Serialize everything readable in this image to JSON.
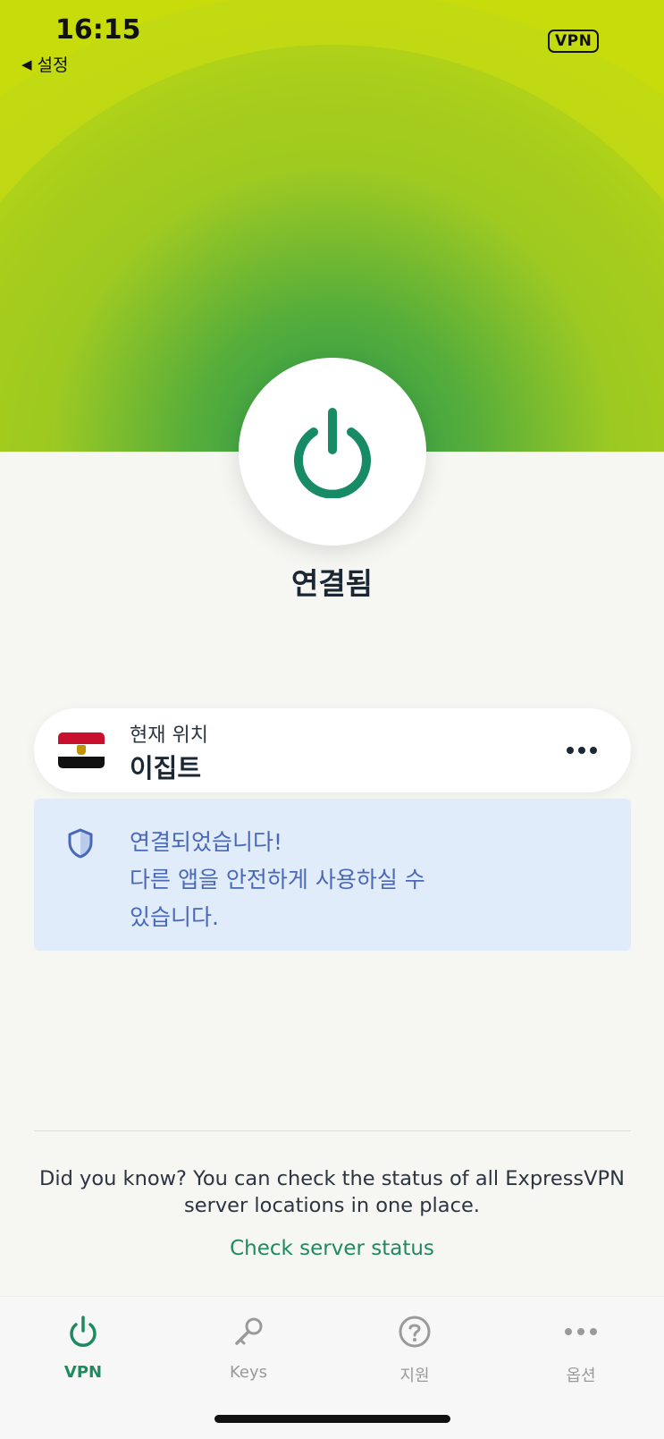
{
  "status_bar": {
    "time": "16:15",
    "back_label": "설정",
    "vpn_badge": "VPN"
  },
  "connection": {
    "status": "연결됨",
    "power_icon": "power-icon"
  },
  "location": {
    "label": "현재 위치",
    "name": "이집트",
    "flag": "egypt-flag",
    "more_icon": "more-horizontal-icon"
  },
  "info_banner": {
    "line1": "연결되었습니다!",
    "line2": "다른 앱을 안전하게 사용하실 수",
    "line3": "있습니다.",
    "icon": "shield-icon"
  },
  "tip": {
    "text": "Did you know? You can check the status of all ExpressVPN server locations in one place.",
    "link": "Check server status"
  },
  "tabs": [
    {
      "label": "VPN",
      "icon": "power-icon",
      "active": true
    },
    {
      "label": "Keys",
      "icon": "key-icon",
      "active": false
    },
    {
      "label": "지원",
      "icon": "help-icon",
      "active": false
    },
    {
      "label": "옵션",
      "icon": "more-icon",
      "active": false
    }
  ],
  "colors": {
    "accent": "#1e8a5e",
    "hero_lime": "#cfe10a",
    "info_text": "#4a68b8",
    "info_bg": "#e1ecfb"
  }
}
